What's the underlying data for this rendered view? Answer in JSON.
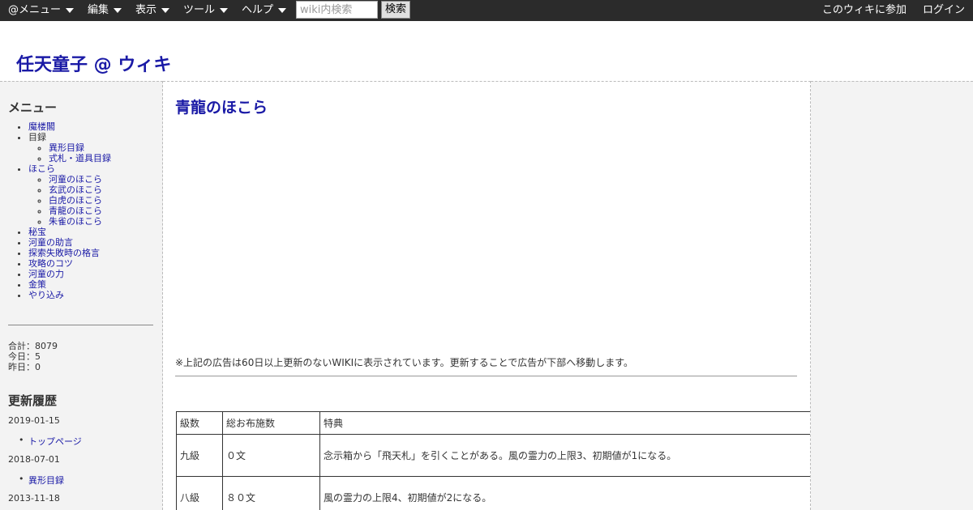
{
  "topbar": {
    "menus": [
      "@メニュー",
      "編集",
      "表示",
      "ツール",
      "ヘルプ"
    ],
    "search_placeholder": "wiki内検索",
    "search_button": "検索",
    "join": "このウィキに参加",
    "login": "ログイン"
  },
  "site": {
    "title": "任天童子 @ ウィキ"
  },
  "sidebar": {
    "menu_heading": "メニュー",
    "items": [
      {
        "label": "魔楼閣",
        "link": true
      },
      {
        "label": "目録",
        "link": false,
        "children": [
          "異形目録",
          "式札・道具目録"
        ]
      },
      {
        "label": "ほこら",
        "link": true,
        "children": [
          "河童のほこら",
          "玄武のほこら",
          "白虎のほこら",
          "青龍のほこら",
          "朱雀のほこら"
        ]
      },
      {
        "label": "秘宝",
        "link": true
      },
      {
        "label": "河童の助言",
        "link": true
      },
      {
        "label": "探索失敗時の格言",
        "link": true
      },
      {
        "label": "攻略のコツ",
        "link": true
      },
      {
        "label": "河童の力",
        "link": true
      },
      {
        "label": "金策",
        "link": true
      },
      {
        "label": "やり込み",
        "link": true
      }
    ],
    "counter": {
      "total": "合計：8079",
      "today": "今日：5",
      "yesterday": "昨日：0"
    },
    "recent_heading": "更新履歴",
    "recent": [
      {
        "date": "2019-01-15",
        "page": "トップページ"
      },
      {
        "date": "2018-07-01",
        "page": "異形目録"
      },
      {
        "date": "2013-11-18",
        "page": ""
      }
    ]
  },
  "main": {
    "page_title": "青龍のほこら",
    "ad_notice": "※上記の広告は60日以上更新のないWIKIに表示されています。更新することで広告が下部へ移動します。",
    "table": {
      "headers": [
        "級数",
        "総お布施数",
        "特典"
      ],
      "rows": [
        [
          "九級",
          "０文",
          "念示箱から「飛天札」を引くことがある。風の霊力の上限3、初期値が1になる。"
        ],
        [
          "八級",
          "８０文",
          "風の霊力の上限4、初期値が2になる。"
        ]
      ]
    }
  },
  "colors": {
    "topbar": "#2b2b2b",
    "link": "#1a1aa6",
    "sidebar_bg": "#f3f3f3"
  },
  "icons": {
    "menu_caret": "caret-down-icon"
  }
}
